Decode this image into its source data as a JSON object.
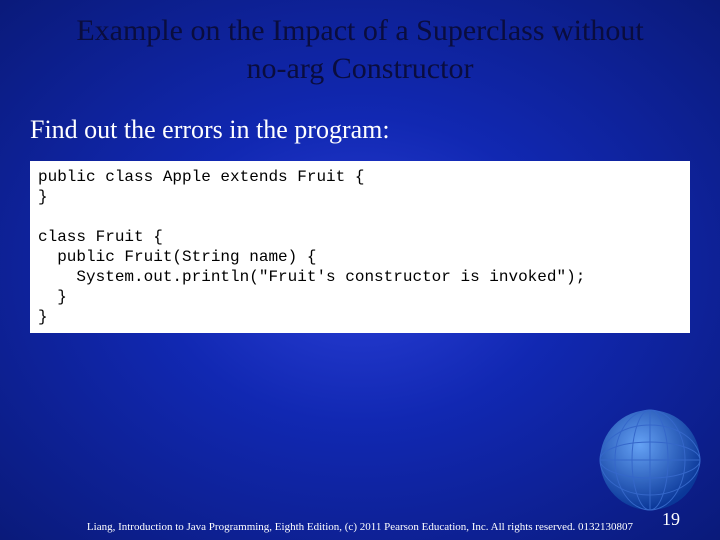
{
  "title": "Example on the Impact of a Superclass without no-arg Constructor",
  "subtitle": "Find out the errors in the program:",
  "code": "public class Apple extends Fruit {\n}\n\nclass Fruit {\n  public Fruit(String name) {\n    System.out.println(\"Fruit's constructor is invoked\");\n  }\n}",
  "footer": "Liang, Introduction to Java Programming, Eighth Edition, (c) 2011 Pearson Education, Inc. All rights reserved. 0132130807",
  "page": "19"
}
